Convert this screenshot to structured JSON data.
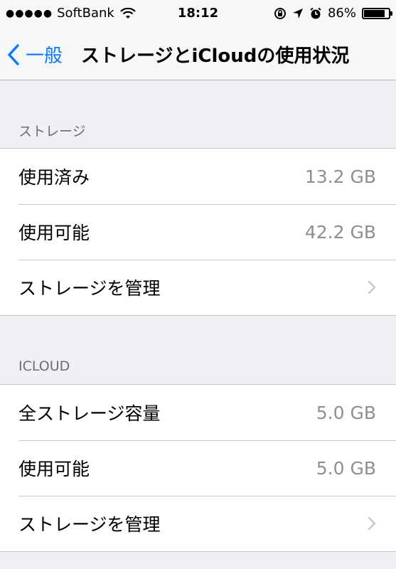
{
  "status_bar": {
    "carrier": "SoftBank",
    "signal_dots": "●●●●●",
    "time": "18:12",
    "battery_percent_label": "86%",
    "battery_level": 0.86
  },
  "nav": {
    "back_label": "一般",
    "title": "ストレージとiCloudの使用状況"
  },
  "storage_section": {
    "header": "ストレージ",
    "rows": [
      {
        "label": "使用済み",
        "value": "13.2 GB"
      },
      {
        "label": "使用可能",
        "value": "42.2 GB"
      },
      {
        "label": "ストレージを管理"
      }
    ]
  },
  "icloud_section": {
    "header": "ICLOUD",
    "rows": [
      {
        "label": "全ストレージ容量",
        "value": "5.0 GB"
      },
      {
        "label": "使用可能",
        "value": "5.0 GB"
      },
      {
        "label": "ストレージを管理"
      }
    ]
  },
  "colors": {
    "accent": "#0a7aff",
    "secondary_text": "#8e8e93",
    "background": "#efeff4"
  }
}
